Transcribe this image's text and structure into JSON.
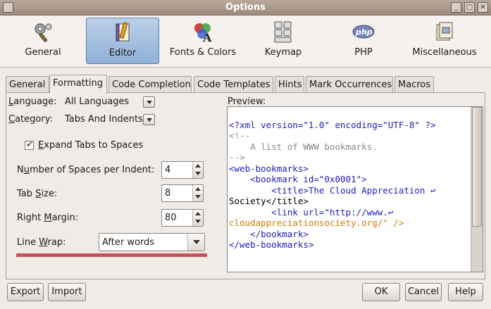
{
  "window": {
    "title": "Options"
  },
  "categories": [
    {
      "label": "General",
      "icon": "gears-icon",
      "selected": false
    },
    {
      "label": "Editor",
      "icon": "pencil-book-icon",
      "selected": true
    },
    {
      "label": "Fonts & Colors",
      "icon": "fonts-colors-icon",
      "selected": false
    },
    {
      "label": "Keymap",
      "icon": "keyboard-icon",
      "selected": false
    },
    {
      "label": "PHP",
      "icon": "php-icon",
      "selected": false
    },
    {
      "label": "Miscellaneous",
      "icon": "misc-icon",
      "selected": false
    }
  ],
  "tabs": [
    {
      "label": "General"
    },
    {
      "label": "Formatting",
      "active": true
    },
    {
      "label": "Code Completion"
    },
    {
      "label": "Code Templates"
    },
    {
      "label": "Hints"
    },
    {
      "label": "Mark Occurrences"
    },
    {
      "label": "Macros"
    }
  ],
  "formatting": {
    "language_label_u": "L",
    "language_label_rest": "anguage:",
    "language_value": "All Languages",
    "category_label_u": "C",
    "category_label_rest": "ategory:",
    "category_value": "Tabs And Indents",
    "expand_tabs_u": "E",
    "expand_tabs_rest": "xpand Tabs to Spaces",
    "expand_tabs_checked": true,
    "spaces_label_pre": "N",
    "spaces_label_u": "u",
    "spaces_label_rest": "mber of Spaces per Indent:",
    "spaces_value": "4",
    "tab_size_label_pre": "Tab ",
    "tab_size_label_u": "S",
    "tab_size_label_rest": "ize:",
    "tab_size_value": "8",
    "right_margin_label_pre": "Right ",
    "right_margin_label_u": "M",
    "right_margin_label_rest": "argin:",
    "right_margin_value": "80",
    "line_wrap_label_pre": "Line ",
    "line_wrap_label_u": "W",
    "line_wrap_label_rest": "rap:",
    "line_wrap_value": "After words"
  },
  "preview": {
    "label": "Preview:",
    "lines": [
      "<?xml version=\"1.0\" encoding=\"UTF-8\" ?>",
      "<!--",
      "    A list of WWW bookmarks.",
      "-->",
      "<web-bookmarks>",
      "    <bookmark id=\"0x0001\">",
      "        <title>The Cloud Appreciation ↩",
      "Society</title>",
      "        <link url=\"http://www.↩",
      "cloudappreciationsociety.org/\" />",
      "    </bookmark>",
      "</web-bookmarks>"
    ]
  },
  "footer": {
    "export_label_pre": "Export",
    "import_label": "Import",
    "ok_label": "OK",
    "cancel_label": "Cancel",
    "help_label": "Help"
  },
  "colors": {
    "accent_selected": "#8fb0d8",
    "highlight_line": "#c9505a"
  }
}
